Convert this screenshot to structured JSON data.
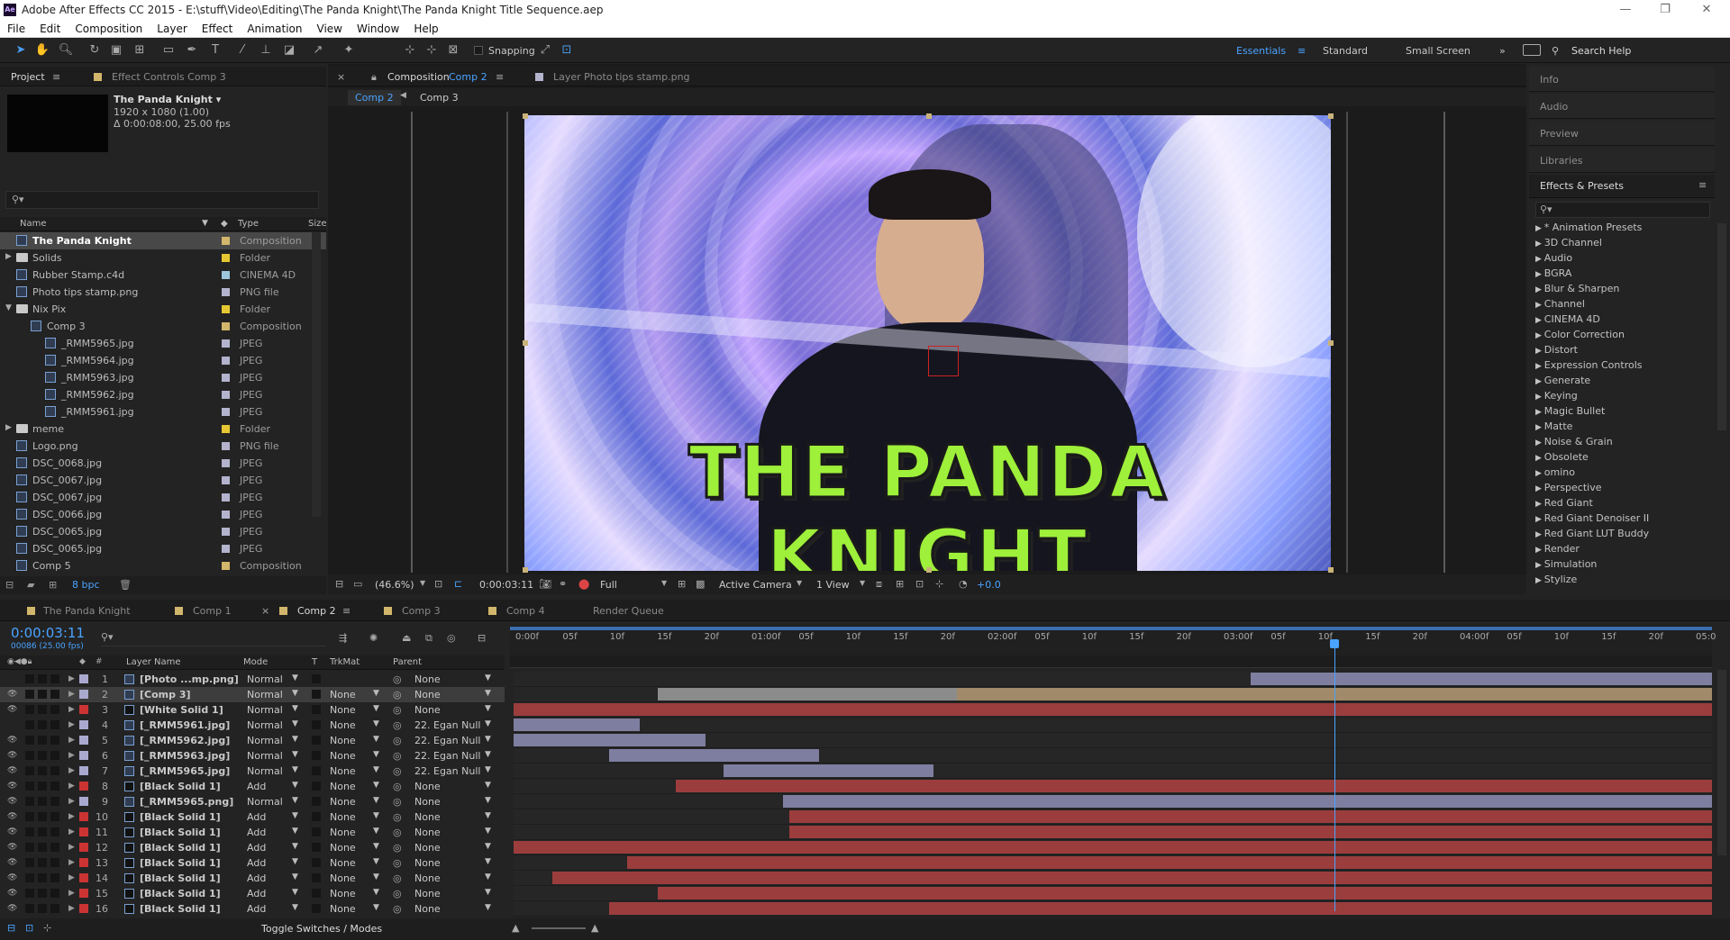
{
  "window": {
    "title": "Adobe After Effects CC 2015 - E:\\stuff\\Video\\Editing\\The Panda Knight\\The Panda Knight Title Sequence.aep",
    "logo": "Ae",
    "min": "—",
    "max": "❐",
    "close": "✕"
  },
  "menu": [
    "File",
    "Edit",
    "Composition",
    "Layer",
    "Effect",
    "Animation",
    "View",
    "Window",
    "Help"
  ],
  "toolbar": {
    "snapping": "Snapping",
    "workspaces": [
      "Essentials",
      "Standard",
      "Small Screen"
    ],
    "search_help": "Search Help"
  },
  "project": {
    "tabs": [
      "Project",
      "Effect Controls Comp 3"
    ],
    "selected_name": "The Panda Knight ▾",
    "selected_size": "1920 x 1080 (1.00)",
    "selected_duration": "Δ 0:00:08:00, 25.00 fps",
    "col_name": "Name",
    "col_type": "Type",
    "col_size": "Size",
    "bpc": "8 bpc",
    "items": [
      {
        "name": "The Panda Knight",
        "type": "Composition",
        "color": "#d2b66b",
        "indent": 0,
        "kind": "comp"
      },
      {
        "name": "Solids",
        "type": "Folder",
        "color": "#e6c732",
        "indent": 0,
        "kind": "folder"
      },
      {
        "name": "Rubber Stamp.c4d",
        "type": "CINEMA 4D",
        "color": "#9bc6dc",
        "indent": 0,
        "kind": "file"
      },
      {
        "name": "Photo tips stamp.png",
        "type": "PNG file",
        "color": "#b3b3ce",
        "indent": 0,
        "kind": "file"
      },
      {
        "name": "Nix Pix",
        "type": "Folder",
        "color": "#e6c732",
        "indent": 0,
        "kind": "folder"
      },
      {
        "name": "Comp 3",
        "type": "Composition",
        "color": "#d2b66b",
        "indent": 1,
        "kind": "comp"
      },
      {
        "name": "_RMM5965.jpg",
        "type": "JPEG",
        "color": "#b3b3ce",
        "indent": 2,
        "kind": "file"
      },
      {
        "name": "_RMM5964.jpg",
        "type": "JPEG",
        "color": "#b3b3ce",
        "indent": 2,
        "kind": "file"
      },
      {
        "name": "_RMM5963.jpg",
        "type": "JPEG",
        "color": "#b3b3ce",
        "indent": 2,
        "kind": "file"
      },
      {
        "name": "_RMM5962.jpg",
        "type": "JPEG",
        "color": "#b3b3ce",
        "indent": 2,
        "kind": "file"
      },
      {
        "name": "_RMM5961.jpg",
        "type": "JPEG",
        "color": "#b3b3ce",
        "indent": 2,
        "kind": "file"
      },
      {
        "name": "meme",
        "type": "Folder",
        "color": "#e6c732",
        "indent": 0,
        "kind": "folder"
      },
      {
        "name": "Logo.png",
        "type": "PNG file",
        "color": "#b3b3ce",
        "indent": 0,
        "kind": "file"
      },
      {
        "name": "DSC_0068.jpg",
        "type": "JPEG",
        "color": "#b3b3ce",
        "indent": 0,
        "kind": "file"
      },
      {
        "name": "DSC_0067.jpg",
        "type": "JPEG",
        "color": "#b3b3ce",
        "indent": 0,
        "kind": "file"
      },
      {
        "name": "DSC_0067.jpg",
        "type": "JPEG",
        "color": "#b3b3ce",
        "indent": 0,
        "kind": "file"
      },
      {
        "name": "DSC_0066.jpg",
        "type": "JPEG",
        "color": "#b3b3ce",
        "indent": 0,
        "kind": "file"
      },
      {
        "name": "DSC_0065.jpg",
        "type": "JPEG",
        "color": "#b3b3ce",
        "indent": 0,
        "kind": "file"
      },
      {
        "name": "DSC_0065.jpg",
        "type": "JPEG",
        "color": "#b3b3ce",
        "indent": 0,
        "kind": "file"
      },
      {
        "name": "Comp 5",
        "type": "Composition",
        "color": "#d2b66b",
        "indent": 0,
        "kind": "comp"
      }
    ]
  },
  "viewer": {
    "tab_comp_prefix": "Composition",
    "tab_comp": "Comp 2",
    "tab_layer": "Layer Photo tips stamp.png",
    "crumbs": [
      "Comp 2",
      "Comp 3"
    ],
    "title_text": "THE PANDA KNIGHT",
    "zoom": "(46.6%)",
    "timecode": "0:00:03:11",
    "resolution": "Full",
    "camera": "Active Camera",
    "views": "1 View",
    "exposure": "+0.0"
  },
  "side": {
    "panels": [
      "Info",
      "Audio",
      "Preview",
      "Libraries"
    ],
    "effects_title": "Effects & Presets",
    "effects": [
      "* Animation Presets",
      "3D Channel",
      "Audio",
      "BGRA",
      "Blur & Sharpen",
      "Channel",
      "CINEMA 4D",
      "Color Correction",
      "Distort",
      "Expression Controls",
      "Generate",
      "Keying",
      "Magic Bullet",
      "Matte",
      "Noise & Grain",
      "Obsolete",
      "omino",
      "Perspective",
      "Red Giant",
      "Red Giant Denoiser II",
      "Red Giant LUT Buddy",
      "Render",
      "Simulation",
      "Stylize"
    ]
  },
  "timeline": {
    "tabs": [
      "The Panda Knight",
      "Comp 1",
      "Comp 2",
      "Comp 3",
      "Comp 4",
      "Render Queue"
    ],
    "timecode": "0:00:03:11",
    "fps": "00086 (25.00 fps)",
    "col_layer": "Layer Name",
    "col_mode": "Mode",
    "col_t": "T",
    "col_trkmat": "TrkMat",
    "col_parent": "Parent",
    "toggle": "Toggle Switches / Modes",
    "ticks": [
      "0:00f",
      "05f",
      "10f",
      "15f",
      "20f",
      "01:00f",
      "05f",
      "10f",
      "15f",
      "20f",
      "02:00f",
      "05f",
      "10f",
      "15f",
      "20f",
      "03:00f",
      "05f",
      "10f",
      "15f",
      "20f",
      "04:00f",
      "05f",
      "10f",
      "15f",
      "20f",
      "05:0"
    ],
    "layers": [
      {
        "num": "1",
        "name": "[Photo ...mp.png]",
        "mode": "Normal",
        "trkmat": "",
        "parent": "None",
        "color": "#a9a9d0",
        "bar": [
          0.615,
          1.0
        ],
        "bc": "g"
      },
      {
        "num": "2",
        "name": "[Comp 3]",
        "mode": "Normal",
        "trkmat": "None",
        "parent": "None",
        "color": "#a9a9d0",
        "bar": [
          0.12,
          1.0
        ],
        "bc": "t"
      },
      {
        "num": "3",
        "name": "[White Solid 1]",
        "mode": "Normal",
        "trkmat": "None",
        "parent": "None",
        "color": "#c33",
        "bar": [
          0.0,
          1.0
        ],
        "bc": "r"
      },
      {
        "num": "4",
        "name": "[_RMM5961.jpg]",
        "mode": "Normal",
        "trkmat": "None",
        "parent": "22. Egan Null",
        "color": "#a9a9d0",
        "bar": [
          0.0,
          0.105
        ],
        "bc": "g"
      },
      {
        "num": "5",
        "name": "[_RMM5962.jpg]",
        "mode": "Normal",
        "trkmat": "None",
        "parent": "22. Egan Null",
        "color": "#a9a9d0",
        "bar": [
          0.0,
          0.16
        ],
        "bc": "g"
      },
      {
        "num": "6",
        "name": "[_RMM5963.jpg]",
        "mode": "Normal",
        "trkmat": "None",
        "parent": "22. Egan Null",
        "color": "#a9a9d0",
        "bar": [
          0.08,
          0.255
        ],
        "bc": "g"
      },
      {
        "num": "7",
        "name": "[_RMM5965.jpg]",
        "mode": "Normal",
        "trkmat": "None",
        "parent": "22. Egan Null",
        "color": "#a9a9d0",
        "bar": [
          0.175,
          0.35
        ],
        "bc": "g"
      },
      {
        "num": "8",
        "name": "[Black Solid 1]",
        "mode": "Add",
        "trkmat": "None",
        "parent": "None",
        "color": "#c33",
        "bar": [
          0.135,
          1.0
        ],
        "bc": "r"
      },
      {
        "num": "9",
        "name": "[_RMM5965.png]",
        "mode": "Normal",
        "trkmat": "None",
        "parent": "None",
        "color": "#a9a9d0",
        "bar": [
          0.225,
          1.0
        ],
        "bc": "g"
      },
      {
        "num": "10",
        "name": "[Black Solid 1]",
        "mode": "Add",
        "trkmat": "None",
        "parent": "None",
        "color": "#c33",
        "bar": [
          0.23,
          1.0
        ],
        "bc": "r"
      },
      {
        "num": "11",
        "name": "[Black Solid 1]",
        "mode": "Add",
        "trkmat": "None",
        "parent": "None",
        "color": "#c33",
        "bar": [
          0.23,
          1.0
        ],
        "bc": "r"
      },
      {
        "num": "12",
        "name": "[Black Solid 1]",
        "mode": "Add",
        "trkmat": "None",
        "parent": "None",
        "color": "#c33",
        "bar": [
          0.0,
          1.0
        ],
        "bc": "r"
      },
      {
        "num": "13",
        "name": "[Black Solid 1]",
        "mode": "Add",
        "trkmat": "None",
        "parent": "None",
        "color": "#c33",
        "bar": [
          0.095,
          1.0
        ],
        "bc": "r"
      },
      {
        "num": "14",
        "name": "[Black Solid 1]",
        "mode": "Add",
        "trkmat": "None",
        "parent": "None",
        "color": "#c33",
        "bar": [
          0.032,
          1.0
        ],
        "bc": "r"
      },
      {
        "num": "15",
        "name": "[Black Solid 1]",
        "mode": "Add",
        "trkmat": "None",
        "parent": "None",
        "color": "#c33",
        "bar": [
          0.12,
          1.0
        ],
        "bc": "r"
      },
      {
        "num": "16",
        "name": "[Black Solid 1]",
        "mode": "Add",
        "trkmat": "None",
        "parent": "None",
        "color": "#c33",
        "bar": [
          0.08,
          1.0
        ],
        "bc": "r"
      }
    ],
    "playhead": 0.685
  }
}
